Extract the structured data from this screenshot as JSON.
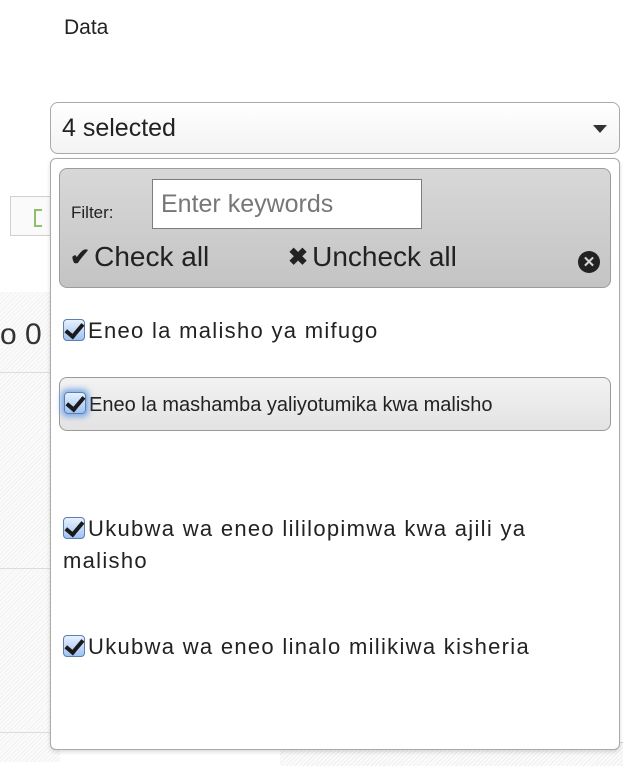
{
  "field": {
    "label": "Data"
  },
  "select": {
    "value": "4 selected"
  },
  "menu": {
    "filter_label": "Filter:",
    "filter_placeholder": "Enter keywords",
    "check_all_icon": "✔",
    "check_all_label": "Check all",
    "uncheck_all_icon": "✖",
    "uncheck_all_label": "Uncheck all",
    "close_icon": "✕",
    "options": [
      {
        "label": "Eneo la malisho ya mifugo",
        "checked": true
      },
      {
        "label": "Eneo la mashamba yaliyotumika kwa malisho",
        "checked": true
      },
      {
        "label": "Ukubwa wa eneo lililopimwa kwa ajili ya malisho",
        "checked": true
      },
      {
        "label": "Ukubwa wa eneo linalo milikiwa kisheria",
        "checked": true
      }
    ]
  },
  "background": {
    "partial_text": "o 0"
  },
  "colors": {
    "checkbox_accent": "#5a96e6",
    "header_bg": "#c8c8c8"
  }
}
